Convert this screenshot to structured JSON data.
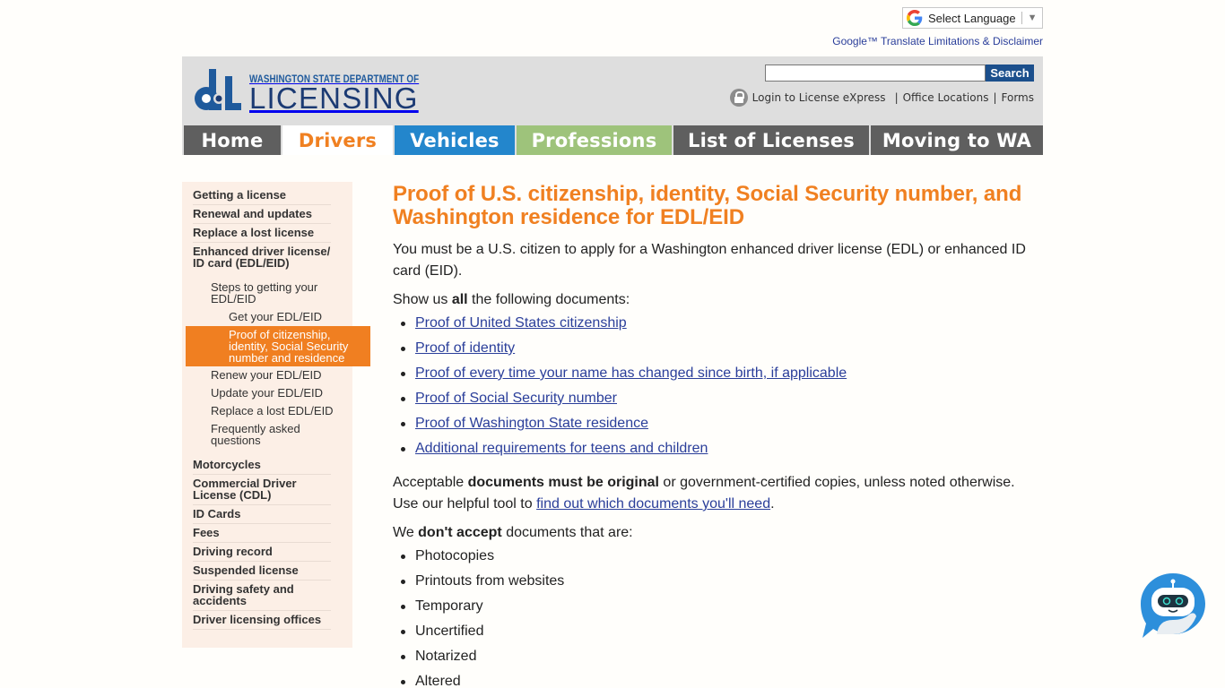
{
  "translate": {
    "label": "Select Language",
    "disclaimer": "Google™ Translate Limitations & Disclaimer"
  },
  "header": {
    "logo_top": "WASHINGTON STATE DEPARTMENT OF",
    "logo_main": "LICENSING",
    "search_placeholder": "",
    "search_button": "Search",
    "links": {
      "login": "Login to License eXpress",
      "offices": "Office Locations",
      "forms": "Forms"
    }
  },
  "nav": {
    "home": "Home",
    "drivers": "Drivers",
    "vehicles": "Vehicles",
    "professions": "Professions",
    "licenses": "List of Licenses",
    "moving": "Moving to WA",
    "colors": {
      "active": "#f08021",
      "vehicles": "#2386cc",
      "professions": "#9ec37b",
      "default": "#5f5f5f"
    }
  },
  "sidebar": {
    "items": [
      "Getting a license",
      "Renewal and updates",
      "Replace a lost license",
      "Enhanced driver license/ ID card (EDL/EID)"
    ],
    "sub": {
      "steps": "Steps to getting your EDL/EID",
      "get": "Get your EDL/EID",
      "active": "Proof of citizenship, identity, Social Security number and residence",
      "renew": "Renew your EDL/EID",
      "update": "Update your EDL/EID",
      "replace": "Replace a lost EDL/EID",
      "faq": "Frequently asked questions"
    },
    "more_items": [
      "Motorcycles",
      "Commercial Driver License (CDL)",
      "ID Cards",
      "Fees",
      "Driving record",
      "Suspended license",
      "Driving safety and accidents",
      "Driver licensing offices"
    ]
  },
  "main": {
    "title": "Proof of U.S. citizenship, identity, Social Security number, and Washington residence for EDL/EID",
    "intro": "You must be a U.S. citizen to apply for a Washington enhanced driver license (EDL) or enhanced ID card (EID).",
    "show_pre": "Show us ",
    "show_bold": "all",
    "show_post": " the following documents:",
    "documents": [
      "Proof of United States citizenship",
      "Proof of identity",
      "Proof of every time your name has changed since birth, if applicable",
      "Proof of Social Security number",
      "Proof of Washington State residence",
      "Additional requirements for teens and children"
    ],
    "orig_pre": "Acceptable ",
    "orig_bold": "documents must be original",
    "orig_post": " or government-certified copies, unless noted otherwise.",
    "tool_pre": "Use our helpful tool to ",
    "tool_link": "find out which documents you'll need",
    "tool_post": ".",
    "dont_pre": "We ",
    "dont_bold": "don't accept",
    "dont_post": " documents that are:",
    "not_accepted": [
      "Photocopies",
      "Printouts from websites",
      "Temporary",
      "Uncertified",
      "Notarized",
      "Altered"
    ]
  },
  "chatbot": {
    "icon": "chatbot-icon"
  }
}
